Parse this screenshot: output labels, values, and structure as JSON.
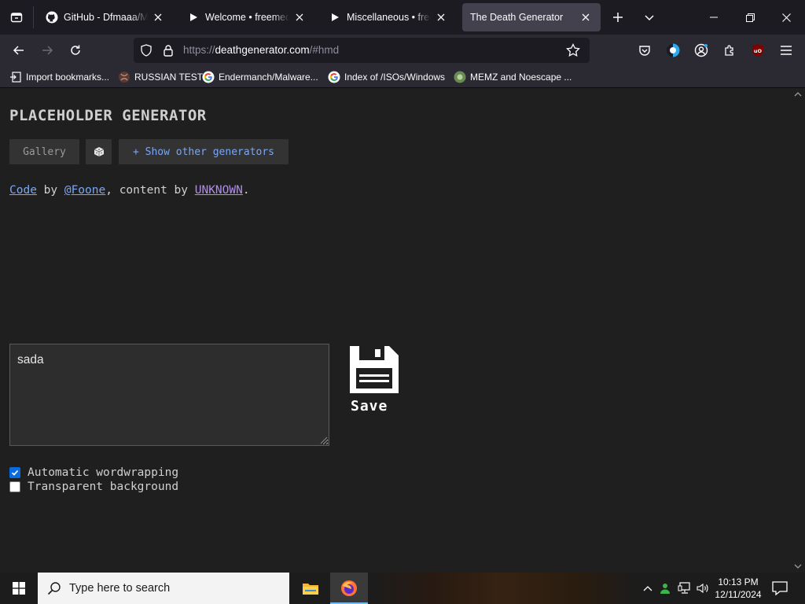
{
  "browser": {
    "tabs": [
      {
        "title": "GitHub - Dfmaaa/MEMZ",
        "icon": "github-icon",
        "active": false
      },
      {
        "title": "Welcome • freemediaheckyeah",
        "icon": "play-icon",
        "active": false
      },
      {
        "title": "Miscellaneous • freemediaheckyeah",
        "icon": "play-icon",
        "active": false
      },
      {
        "title": "The Death Generator",
        "icon": "",
        "active": true
      }
    ],
    "url": {
      "scheme": "https://",
      "host": "deathgenerator.com",
      "path": "/#hmd"
    },
    "bookmarks": [
      {
        "label": "Import bookmarks...",
        "icon": "import-icon"
      },
      {
        "label": "RUSSIAN TEST",
        "icon": "site-icon"
      },
      {
        "label": "Endermanch/Malware...",
        "icon": "google-icon"
      },
      {
        "label": "Index of /ISOs/Windows",
        "icon": "google-icon"
      },
      {
        "label": "MEMZ and Noescape ...",
        "icon": "site-icon"
      }
    ]
  },
  "page": {
    "title": "PLACEHOLDER GENERATOR",
    "buttons": {
      "gallery": "Gallery",
      "random": "⚅",
      "show_other": "+ Show other generators"
    },
    "credits": {
      "code": "Code",
      "by1": " by ",
      "author": "@Foone",
      "sep": ", content by ",
      "content_author": "UNKNOWN",
      "end": "."
    },
    "textarea_value": "sada",
    "save_label": "Save",
    "options": [
      {
        "label": "Automatic wordwrapping",
        "checked": true
      },
      {
        "label": "Transparent background",
        "checked": false
      }
    ]
  },
  "taskbar": {
    "search_placeholder": "Type here to search",
    "time": "10:13 PM",
    "date": "12/11/2024"
  },
  "colors": {
    "accent_link": "#7aa7f5",
    "visited_link": "#b08fe8",
    "checkbox_on": "#0a6be0"
  }
}
